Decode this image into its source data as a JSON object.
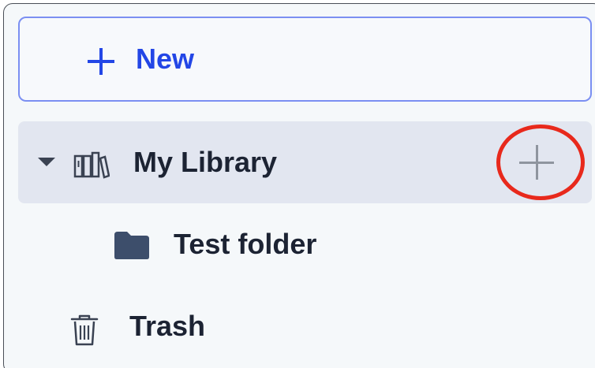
{
  "new_button": {
    "label": "New",
    "icon": "plus-icon"
  },
  "tree": {
    "library": {
      "label": "My Library",
      "expanded": true,
      "icon": "library-icon",
      "add_icon": "plus-icon"
    },
    "folders": [
      {
        "label": "Test folder",
        "icon": "folder-icon"
      }
    ],
    "trash": {
      "label": "Trash",
      "icon": "trash-icon"
    }
  },
  "colors": {
    "accent": "#2346e6",
    "selected_row": "#e2e6f0",
    "text": "#1c2333",
    "highlight": "#e8291c",
    "panel_bg": "#f5f8fa"
  }
}
